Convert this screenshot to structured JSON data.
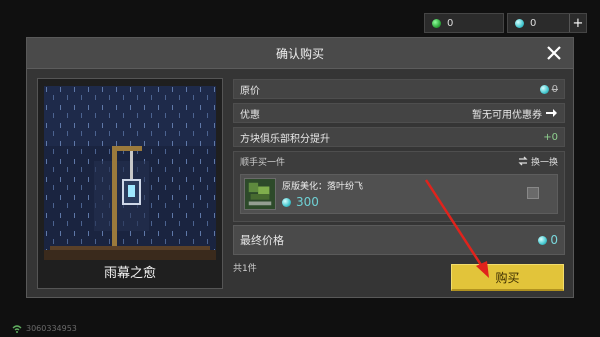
{
  "currency": {
    "emerald_count": "0",
    "diamond_count": "0",
    "add_label": "+"
  },
  "dialog": {
    "title": "确认购买"
  },
  "product": {
    "name": "雨幕之愈"
  },
  "price": {
    "original_label": "原价",
    "original_value": "0",
    "discount_label": "优惠",
    "discount_value": "暂无可用优惠券",
    "club_label": "方块俱乐部积分提升",
    "club_value": "+0"
  },
  "addon": {
    "header": "顺手买一件",
    "swap_label": "换一换",
    "item_name": "原版美化：落叶纷飞",
    "item_price": "300",
    "selected": false
  },
  "final": {
    "label": "最终价格",
    "value": "0"
  },
  "count_label": "共1件",
  "buy_label": "购买",
  "footer": {
    "user_id": "3060334953"
  },
  "colors": {
    "accent_yellow": "#e2c43a",
    "diamond": "#44c7cf",
    "emerald": "#2faa3c",
    "annotation_red": "#e0231c"
  }
}
